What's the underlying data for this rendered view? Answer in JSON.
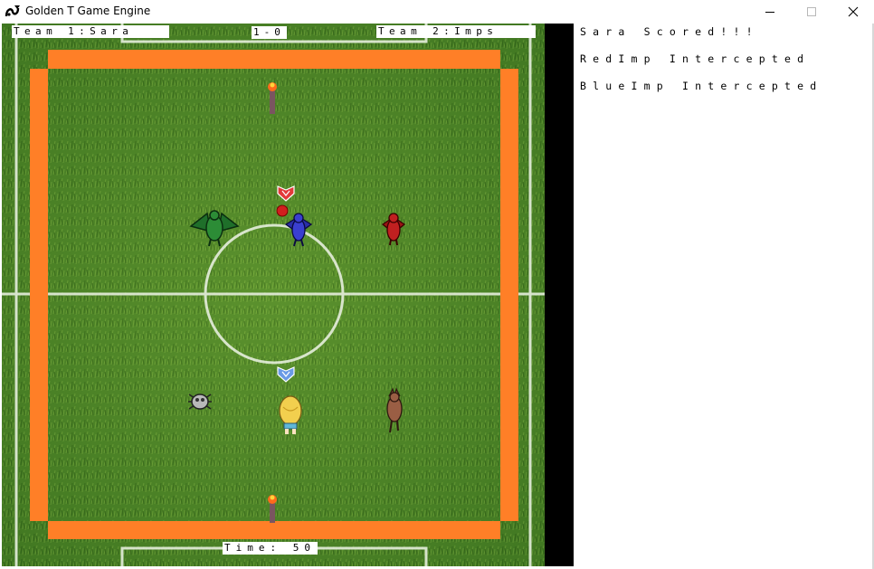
{
  "window": {
    "title": "Golden T Game Engine",
    "icon": "golden-t-logo-icon",
    "controls": [
      "minimize-icon",
      "maximize-icon",
      "close-icon"
    ]
  },
  "hud": {
    "team1": "Team 1:Sara",
    "score": "1-0",
    "team2": "Team 2:Imps",
    "time_label": "Time:",
    "time_value": "50"
  },
  "log": [
    "Sara Scored!!!",
    "RedImp Intercepted",
    "BlueImp Intercepted"
  ],
  "colors": {
    "wall": "#ff7f27",
    "grass": "#4f8a2a",
    "line": "#e8efe0",
    "sidebar": "#000000"
  },
  "sprites": [
    "goal-torch-top",
    "goal-torch-bottom",
    "green-dragon",
    "blue-imp",
    "red-imp",
    "red-heart-marker",
    "red-ball",
    "grey-spider",
    "sara",
    "blue-heart-marker",
    "brown-imp"
  ]
}
